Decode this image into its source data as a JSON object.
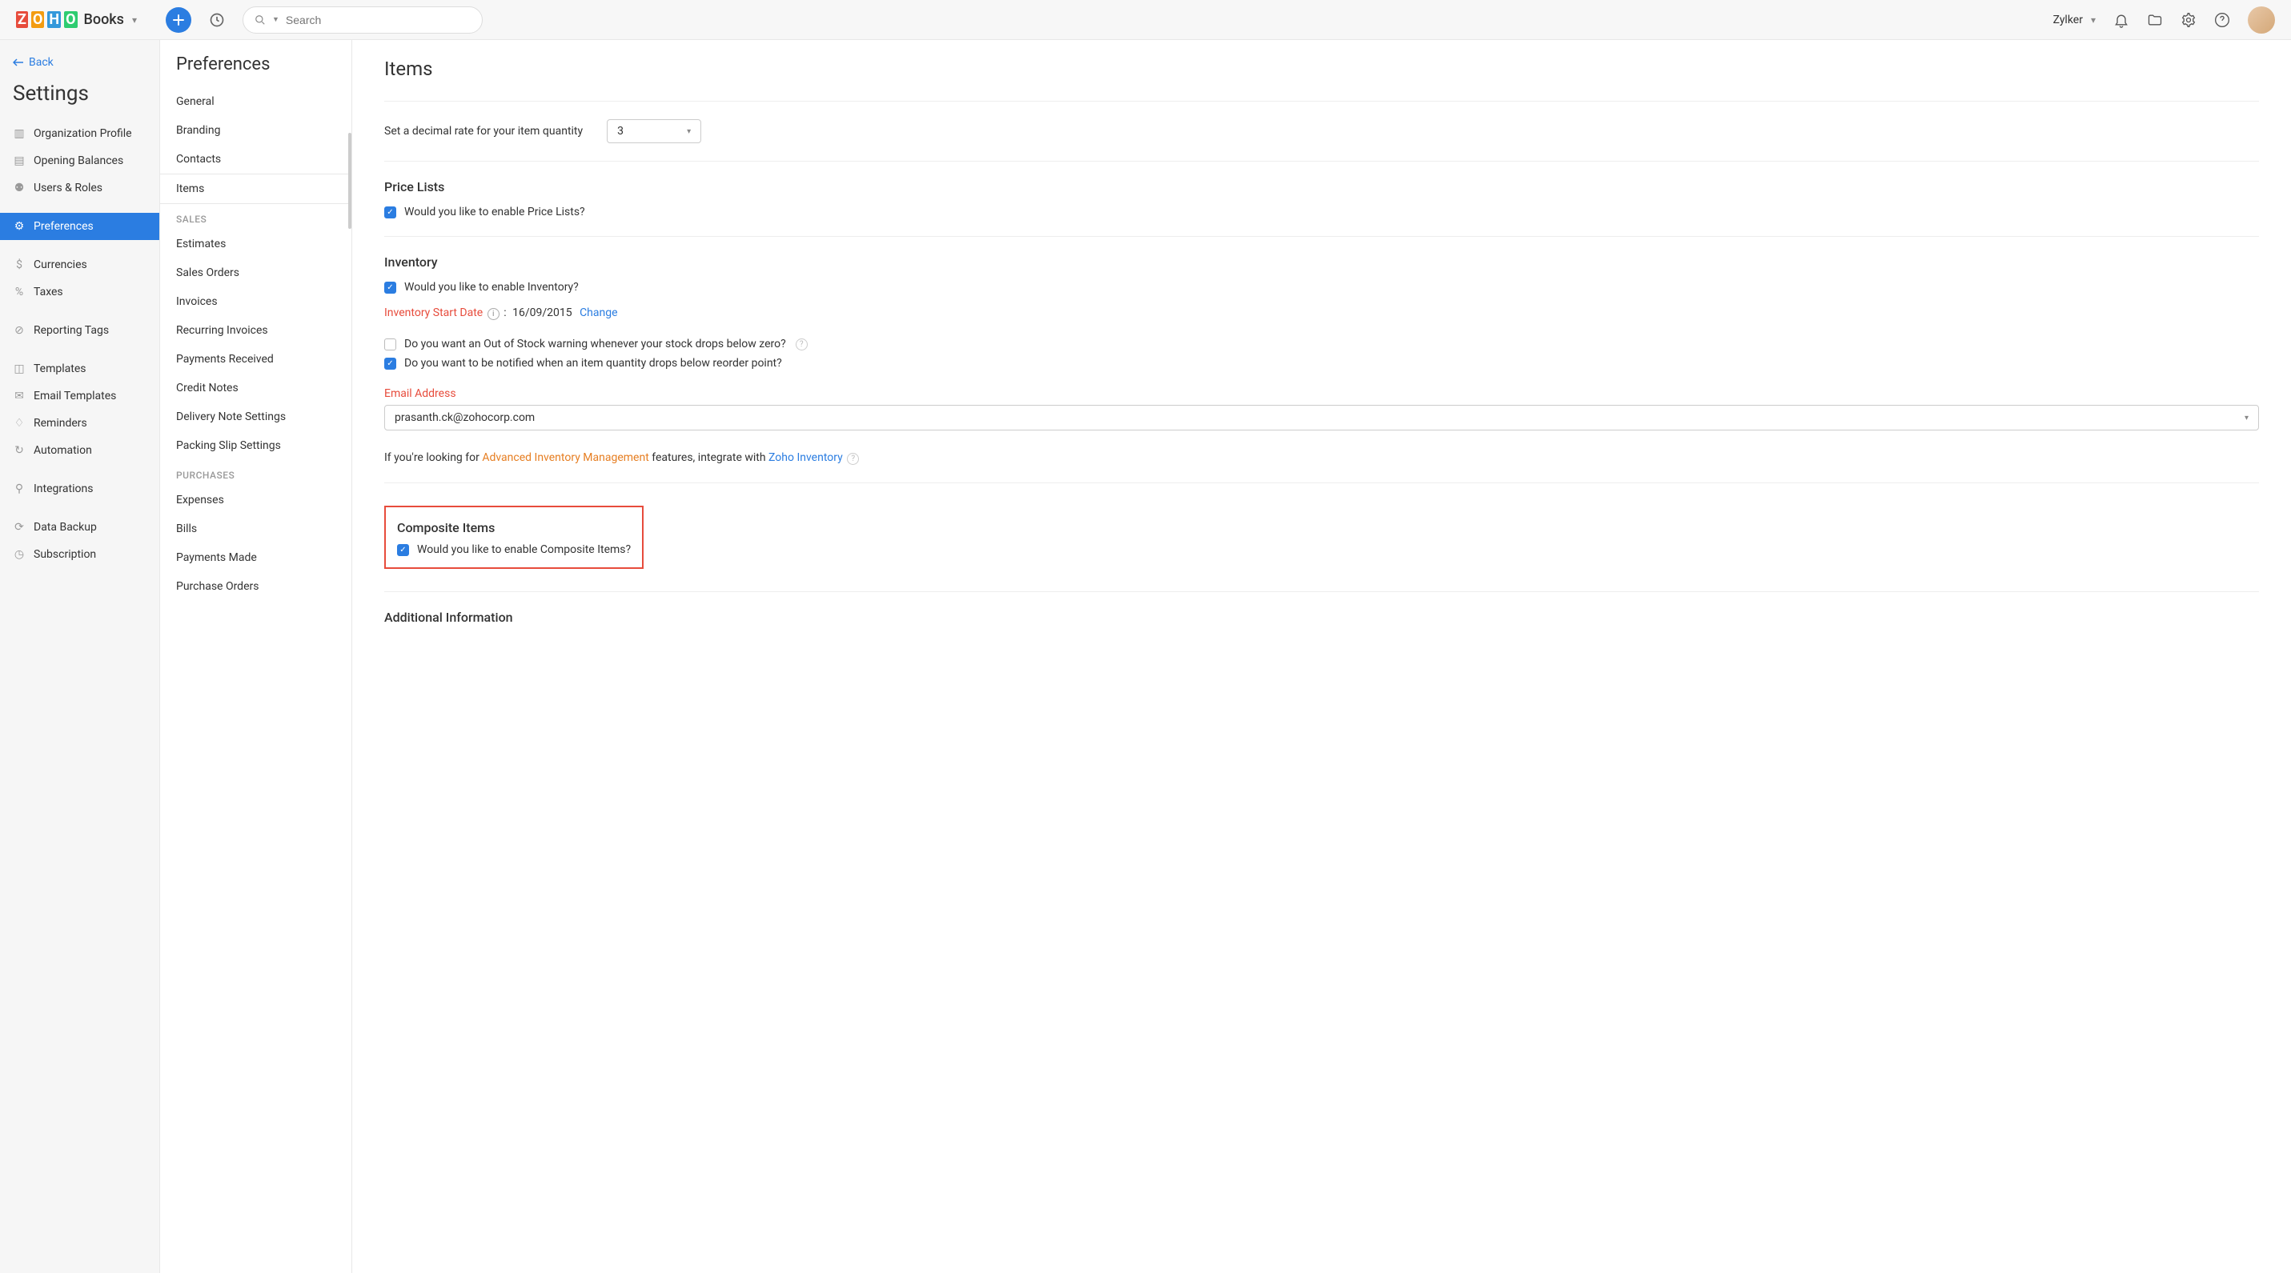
{
  "topbar": {
    "brand": "Books",
    "search_placeholder": "Search",
    "org": "Zylker"
  },
  "settings": {
    "back": "Back",
    "title": "Settings",
    "items": [
      "Organization Profile",
      "Opening Balances",
      "Users & Roles",
      "Preferences",
      "Currencies",
      "Taxes",
      "Reporting Tags",
      "Templates",
      "Email Templates",
      "Reminders",
      "Automation",
      "Integrations",
      "Data Backup",
      "Subscription"
    ]
  },
  "prefs": {
    "title": "Preferences",
    "general": [
      "General",
      "Branding",
      "Contacts",
      "Items"
    ],
    "sales_header": "SALES",
    "sales": [
      "Estimates",
      "Sales Orders",
      "Invoices",
      "Recurring Invoices",
      "Payments Received",
      "Credit Notes",
      "Delivery Note Settings",
      "Packing Slip Settings"
    ],
    "purchases_header": "PURCHASES",
    "purchases": [
      "Expenses",
      "Bills",
      "Payments Made",
      "Purchase Orders"
    ]
  },
  "main": {
    "title": "Items",
    "decimal_label": "Set a decimal rate for your item quantity",
    "decimal_value": "3",
    "pricelists": {
      "heading": "Price Lists",
      "enable": "Would you like to enable Price Lists?"
    },
    "inventory": {
      "heading": "Inventory",
      "enable": "Would you like to enable Inventory?",
      "start_date_label": "Inventory Start Date",
      "start_date_sep": ":",
      "start_date_value": "16/09/2015",
      "change": "Change",
      "out_of_stock": "Do you want an Out of Stock warning whenever your stock drops below zero?",
      "reorder": "Do you want to be notified when an item quantity drops below reorder point?",
      "email_label": "Email Address",
      "email_value": "prasanth.ck@zohocorp.com",
      "adv_pre": "If you're looking for ",
      "adv_link": "Advanced Inventory Management",
      "adv_mid": " features, integrate with ",
      "zoho_inv": "Zoho Inventory"
    },
    "composite": {
      "heading": "Composite Items",
      "enable": "Would you like to enable Composite Items?"
    },
    "additional": {
      "heading": "Additional Information"
    }
  }
}
